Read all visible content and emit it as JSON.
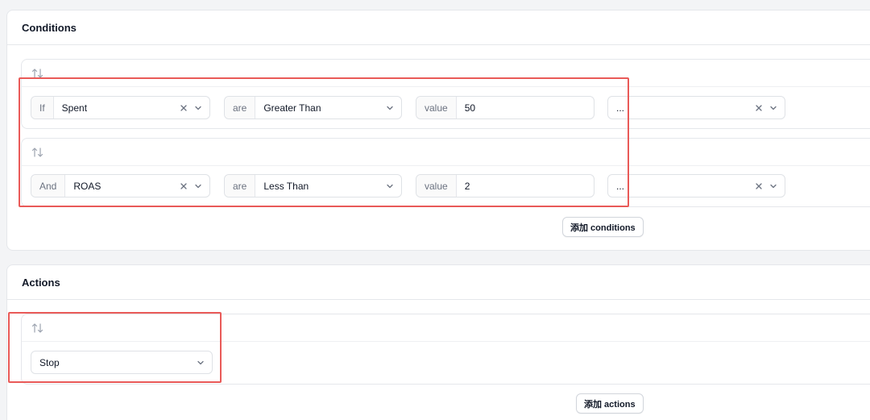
{
  "conditions": {
    "title": "Conditions",
    "rows": [
      {
        "connector": "If",
        "field": "Spent",
        "operator_prefix": "are",
        "operator": "Greater Than",
        "value_prefix": "value",
        "value": "50",
        "extra": "..."
      },
      {
        "connector": "And",
        "field": "ROAS",
        "operator_prefix": "are",
        "operator": "Less Than",
        "value_prefix": "value",
        "value": "2",
        "extra": "..."
      }
    ],
    "add_label": "添加 conditions"
  },
  "actions": {
    "title": "Actions",
    "rows": [
      {
        "action": "Stop"
      }
    ],
    "add_label": "添加 actions"
  },
  "colors": {
    "highlight": "#e95a58",
    "border": "#e5e7eb",
    "background": "#f3f4f6"
  }
}
